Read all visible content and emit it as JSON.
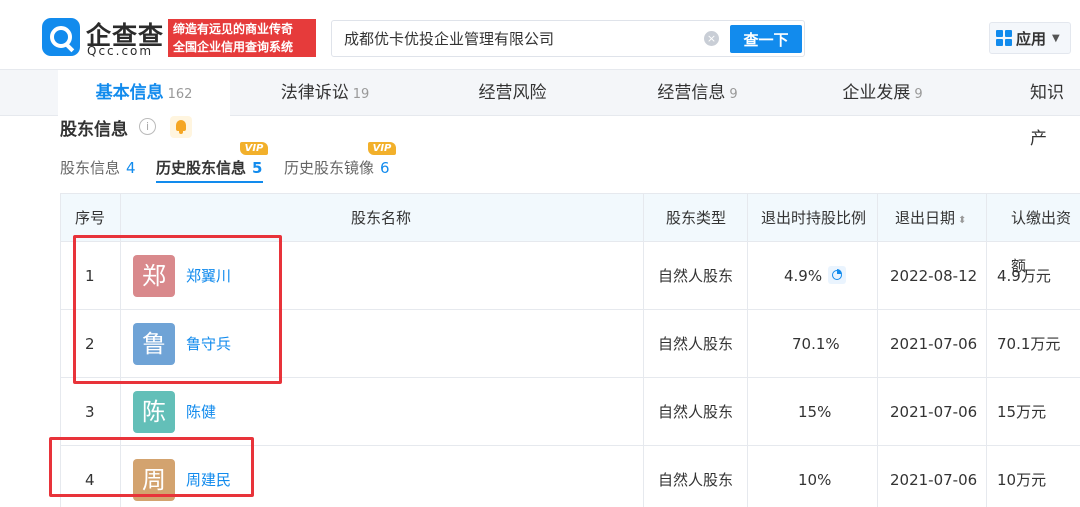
{
  "header": {
    "logo_name": "企查查",
    "logo_sub": "Qcc.com",
    "slogan_line1": "缔造有远见的商业传奇",
    "slogan_line2": "全国企业信用查询系统",
    "search_value": "成都优卡优投企业管理有限公司",
    "clear_icon": "×",
    "search_button": "查一下",
    "apps_label": "应用",
    "caret": "▼"
  },
  "tabs": [
    {
      "label": "基本信息",
      "count": "162"
    },
    {
      "label": "法律诉讼",
      "count": "19"
    },
    {
      "label": "经营风险",
      "count": ""
    },
    {
      "label": "经营信息",
      "count": "9"
    },
    {
      "label": "企业发展",
      "count": "9"
    },
    {
      "label": "知识产",
      "count": ""
    }
  ],
  "section": {
    "title": "股东信息",
    "info_icon": "i"
  },
  "subtabs": [
    {
      "label": "股东信息",
      "count": "4"
    },
    {
      "label": "历史股东信息",
      "count": "5",
      "vip": "VIP"
    },
    {
      "label": "历史股东镜像",
      "count": "6",
      "vip": "VIP"
    }
  ],
  "table": {
    "headers": {
      "index": "序号",
      "name": "股东名称",
      "type": "股东类型",
      "ratio": "退出时持股比例",
      "date": "退出日期",
      "sort_icon": "⬍",
      "capital": "认缴出资额"
    },
    "rows": [
      {
        "index": "1",
        "avatar": "郑",
        "avatar_color": "#d9898c",
        "name": "郑翼川",
        "type": "自然人股东",
        "ratio": "4.9%",
        "date": "2022-08-12",
        "capital": "4.9万元"
      },
      {
        "index": "2",
        "avatar": "鲁",
        "avatar_color": "#6fa3d6",
        "name": "鲁守兵",
        "type": "自然人股东",
        "ratio": "70.1%",
        "date": "2021-07-06",
        "capital": "70.1万元"
      },
      {
        "index": "3",
        "avatar": "陈",
        "avatar_color": "#63bfb8",
        "name": "陈健",
        "type": "自然人股东",
        "ratio": "15%",
        "date": "2021-07-06",
        "capital": "15万元"
      },
      {
        "index": "4",
        "avatar": "周",
        "avatar_color": "#d3a36f",
        "name": "周建民",
        "type": "自然人股东",
        "ratio": "10%",
        "date": "2021-07-06",
        "capital": "10万元"
      }
    ]
  },
  "colors": {
    "brand": "#128bed",
    "highlight": "#e8333a"
  }
}
